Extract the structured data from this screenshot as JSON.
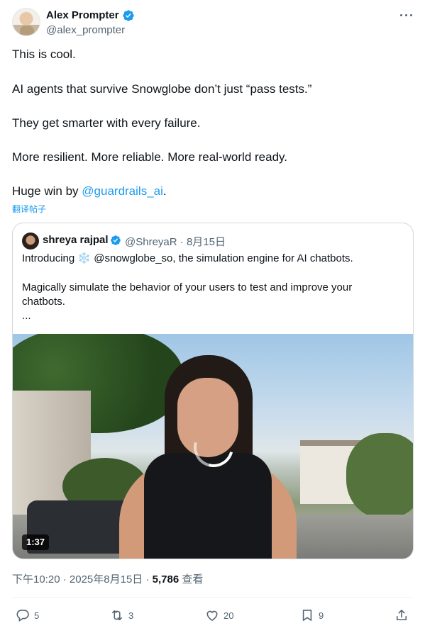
{
  "author": {
    "name": "Alex Prompter",
    "handle": "@alex_prompter",
    "verified_color": "#1d9bf0"
  },
  "tweet": {
    "lines": [
      "This is cool.",
      "AI agents that survive Snowglobe don’t just “pass tests.”",
      "They get smarter with every failure.",
      "More resilient. More reliable. More real-world ready."
    ],
    "last_line_prefix": "Huge win by ",
    "last_line_mention": "@guardrails_ai",
    "last_line_suffix": ".",
    "translate_label": "翻译帖子"
  },
  "quote": {
    "name": "shreya rajpal",
    "handle": "@ShreyaR",
    "date": "8月15日",
    "separator": "·",
    "line1_prefix": "Introducing ",
    "line1_icon": "❄️",
    "line1_suffix": " @snowglobe_so, the simulation engine for AI chatbots.",
    "line2": "Magically simulate the behavior of your users to test and improve your",
    "line3": "chatbots.",
    "ellipsis": "...",
    "video_duration": "1:37"
  },
  "meta": {
    "time": "下午10:20",
    "date": "2025年8月15日",
    "views_count": "5,786",
    "views_label": "查看",
    "separator": "·"
  },
  "actions": {
    "replies": "5",
    "retweets": "3",
    "likes": "20",
    "bookmarks": "9"
  },
  "colors": {
    "accent": "#1d9bf0",
    "secondary_text": "#536471",
    "border": "#cfd9de"
  }
}
